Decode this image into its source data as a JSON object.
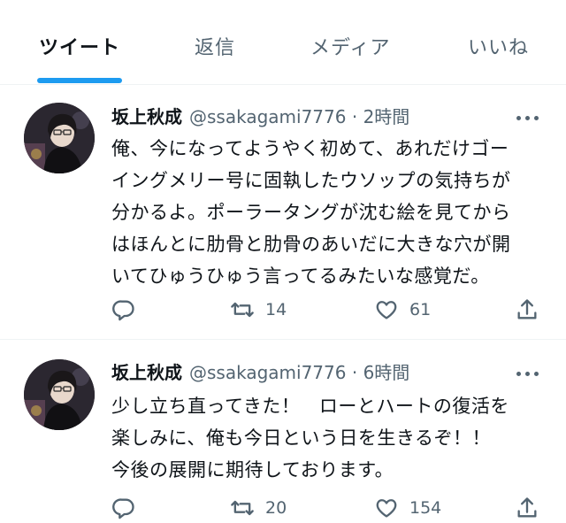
{
  "tabs": [
    {
      "label": "ツイート",
      "active": true
    },
    {
      "label": "返信",
      "active": false
    },
    {
      "label": "メディア",
      "active": false
    },
    {
      "label": "いいね",
      "active": false
    }
  ],
  "colors": {
    "accent": "#1d9bf0",
    "text": "#0f1419",
    "secondary": "#536471",
    "divider": "#eff3f4"
  },
  "tweets": [
    {
      "name": "坂上秋成",
      "handle": "@ssakagami7776",
      "separator": "·",
      "time": "2時間",
      "text": "俺、今になってようやく初めて、あれだけゴー\nイングメリー号に固執したウソップの気持ちが\n分かるよ。ポーラータングが沈む絵を見てから\nはほんとに肋骨と肋骨のあいだに大きな穴が開\nいてひゅうひゅう言ってるみたいな感覚だ。",
      "replies": "",
      "retweets": "14",
      "likes": "61",
      "icons": [
        "reply-icon",
        "retweet-icon",
        "like-icon",
        "share-icon"
      ]
    },
    {
      "name": "坂上秋成",
      "handle": "@ssakagami7776",
      "separator": "·",
      "time": "6時間",
      "text": "少し立ち直ってきた！　ローとハートの復活を\n楽しみに、俺も今日という日を生きるぞ！！\n今後の展開に期待しております。",
      "replies": "",
      "retweets": "20",
      "likes": "154",
      "icons": [
        "reply-icon",
        "retweet-icon",
        "like-icon",
        "share-icon"
      ]
    }
  ]
}
